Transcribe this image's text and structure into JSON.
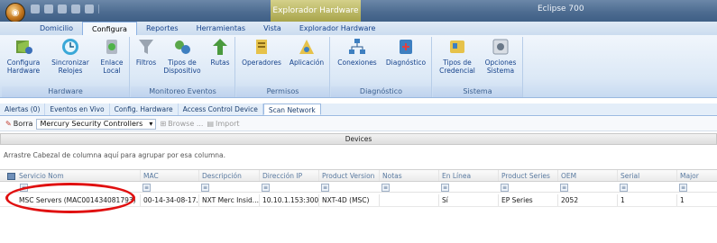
{
  "titlebar": {
    "orb_icon": "app-orb-icon",
    "window_title": "Explorador Hardware",
    "app_name": "Eclipse 700"
  },
  "ribbon_tabs": [
    "Domicilio",
    "Configura",
    "Reportes",
    "Herramientas",
    "Vista",
    "Explorador Hardware"
  ],
  "active_ribbon_tab": "Configura",
  "ribbon": {
    "groups": [
      {
        "title": "Hardware",
        "buttons": [
          {
            "label_1": "Configura",
            "label_2": "Hardware",
            "icon": "hardware-config-icon"
          },
          {
            "label_1": "Sincronizar",
            "label_2": "Relojes",
            "icon": "sync-clock-icon"
          },
          {
            "label_1": "Enlace",
            "label_2": "Local",
            "icon": "local-link-icon"
          }
        ]
      },
      {
        "title": "Monitoreo Eventos",
        "buttons": [
          {
            "label_1": "Filtros",
            "label_2": "",
            "icon": "filter-icon"
          },
          {
            "label_1": "Tipos de",
            "label_2": "Dispositivo",
            "icon": "device-types-icon"
          },
          {
            "label_1": "Rutas",
            "label_2": "",
            "icon": "routes-icon"
          }
        ]
      },
      {
        "title": "Permisos",
        "buttons": [
          {
            "label_1": "Operadores",
            "label_2": "",
            "icon": "operators-icon"
          },
          {
            "label_1": "Aplicación",
            "label_2": "",
            "icon": "application-icon"
          }
        ]
      },
      {
        "title": "Diagnóstico",
        "buttons": [
          {
            "label_1": "Conexiones",
            "label_2": "",
            "icon": "connections-icon"
          },
          {
            "label_1": "Diagnóstico",
            "label_2": "",
            "icon": "diagnostic-icon"
          }
        ]
      },
      {
        "title": "Sistema",
        "buttons": [
          {
            "label_1": "Tipos de",
            "label_2": "Credencial",
            "icon": "credential-types-icon"
          },
          {
            "label_1": "Opciones",
            "label_2": "Sistema",
            "icon": "system-options-icon"
          }
        ]
      }
    ]
  },
  "doc_tabs": [
    "Alertas (0)",
    "Eventos en Vivo",
    "Config. Hardware",
    "Access Control Device",
    "Scan Network"
  ],
  "active_doc_tab": "Scan Network",
  "toolbar": {
    "delete_label": "Borra",
    "controller_select": "Mercury Security Controllers",
    "browse_label": "Browse ...",
    "import_label": "Import"
  },
  "grid": {
    "caption": "Devices",
    "group_hint": "Arrastre Cabezal de columna aquí para agrupar por esa columna.",
    "columns": [
      "Servicio Nom",
      "MAC",
      "Descripción",
      "Dirección IP",
      "Product Version",
      "Notas",
      "En Línea",
      "Product Series",
      "OEM",
      "Serial",
      "Major"
    ],
    "rows": [
      [
        "MSC Servers (MAC001434081793)",
        "00-14-34-08-17...",
        "NXT Merc Insid...",
        "10.10.1.153:3001",
        "NXT-4D (MSC)",
        "",
        "Sí",
        "EP Series",
        "2052",
        "1",
        "1"
      ]
    ]
  },
  "colors": {
    "ribbon_text": "#15428b",
    "highlight_oval": "#e01010",
    "header_text": "#5a7aa0"
  }
}
